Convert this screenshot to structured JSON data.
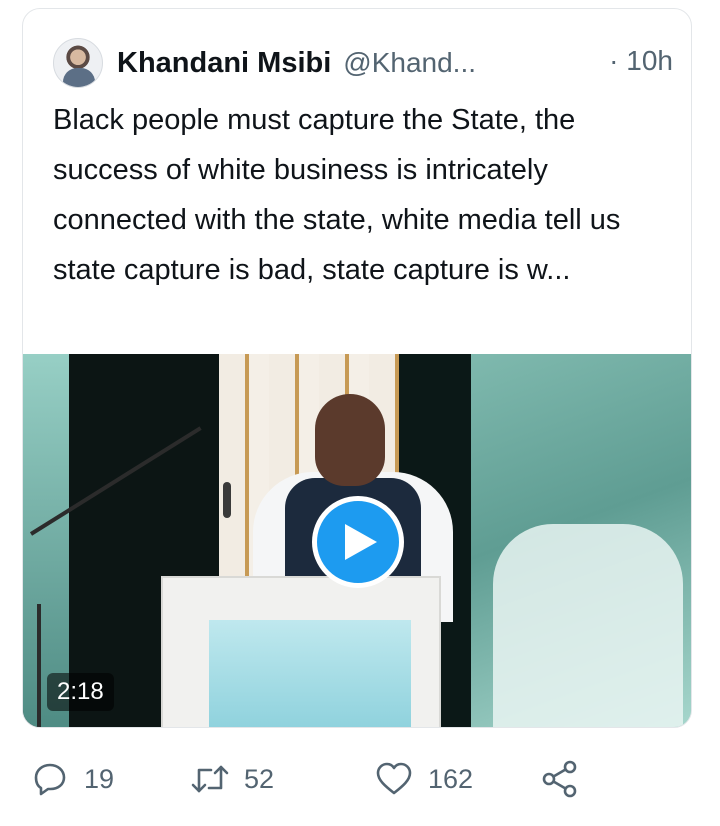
{
  "tweet": {
    "author_name": "Khandani Msibi",
    "author_handle": "@Khand...",
    "time": "· 10h",
    "text": "Black people must capture the State, the success of white business is intricately connected with the state, white media tell us state capture is bad, state capture is w...",
    "video": {
      "duration": "2:18"
    }
  },
  "actions": {
    "replies": "19",
    "retweets": "52",
    "likes": "162"
  },
  "icons": {
    "avatar": "avatar",
    "play": "play-icon",
    "reply": "reply-icon",
    "retweet": "retweet-icon",
    "like": "heart-icon",
    "share": "share-icon"
  },
  "colors": {
    "accent": "#1d9bf0",
    "text_primary": "#0f1419",
    "text_secondary": "#536471"
  }
}
